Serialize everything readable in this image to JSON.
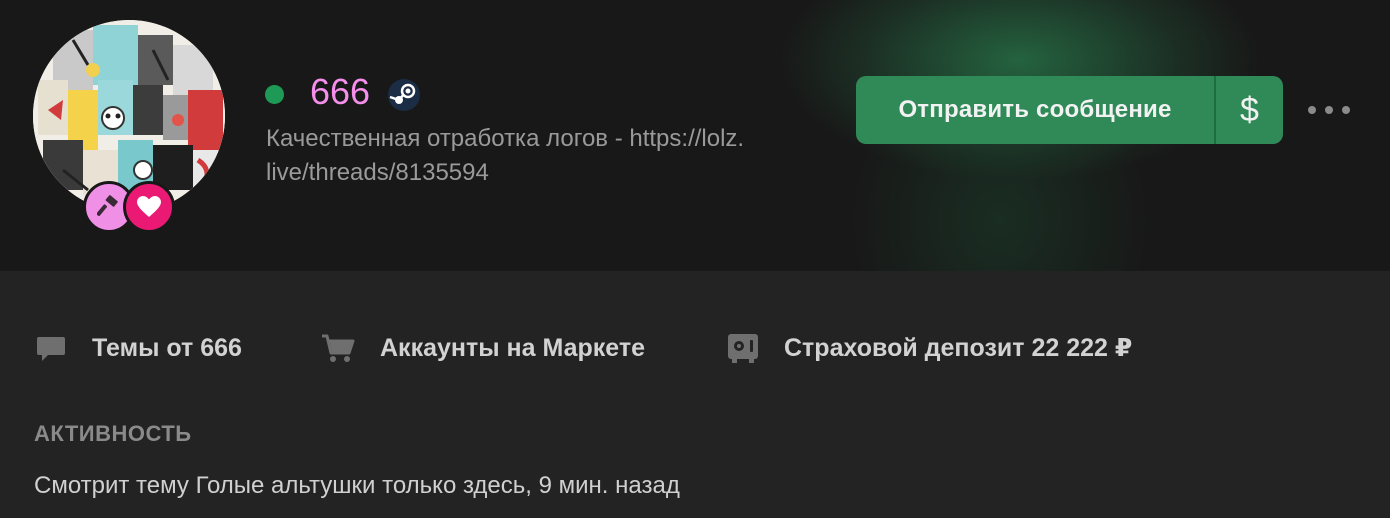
{
  "profile": {
    "username": "666",
    "status_text": "Качественная отработка логов - https://lolz.live/threads/8135594",
    "online": true,
    "online_color": "#1f9a56",
    "username_color": "#f58fec",
    "badges": [
      "gavel-icon",
      "heart-icon"
    ],
    "linked_service_icon": "steam-icon"
  },
  "actions": {
    "send_message_label": "Отправить сообщение",
    "money_label": "$",
    "more_icon": "more-dots-icon",
    "accent_color": "#2f8a58"
  },
  "links": [
    {
      "label": "Темы от 666",
      "icon": "chat-bubble-icon"
    },
    {
      "label": "Аккаунты на Маркете",
      "icon": "cart-icon"
    },
    {
      "label": "Страховой депозит 22 222 ₽",
      "icon": "safe-icon"
    }
  ],
  "activity": {
    "title": "АКТИВНОСТЬ",
    "text": "Смотрит тему Голые альтушки только здесь, 9 мин. назад"
  }
}
